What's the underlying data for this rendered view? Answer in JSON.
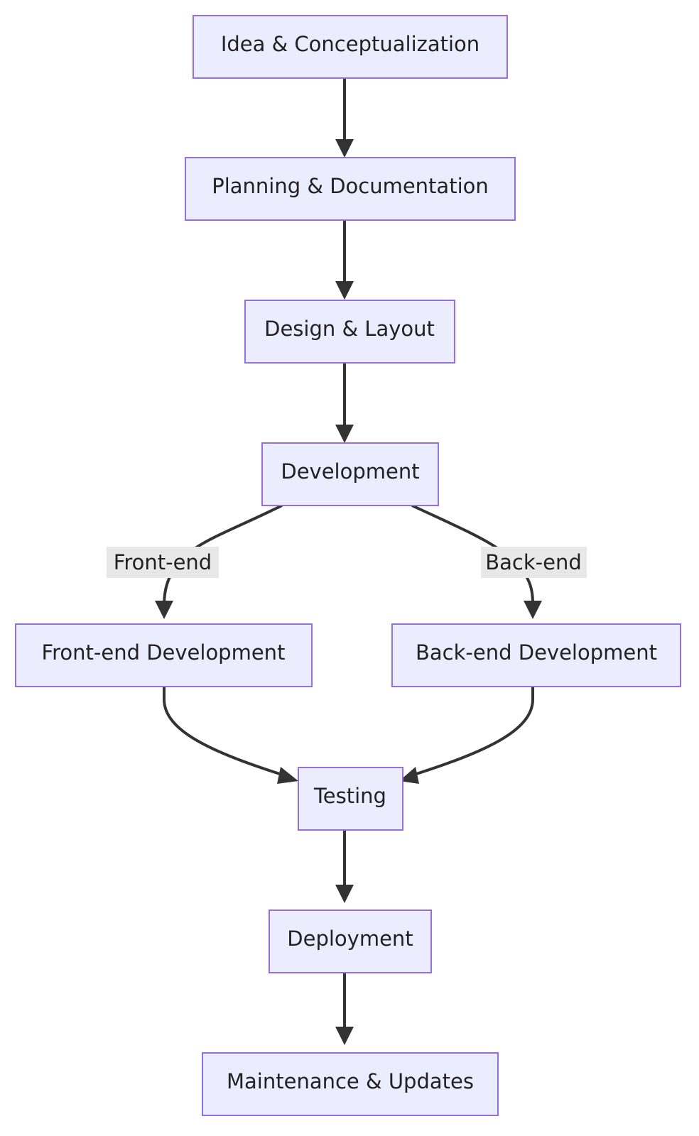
{
  "diagram": {
    "type": "flowchart",
    "direction": "top-to-bottom",
    "colors": {
      "node_fill": "#ECECFF",
      "node_stroke": "#9370DB",
      "edge": "#333333",
      "label_background": "#E8E8E8",
      "text": "#222222"
    },
    "nodes": [
      {
        "id": "idea",
        "label": "Idea & Conceptualization"
      },
      {
        "id": "planning",
        "label": "Planning & Documentation"
      },
      {
        "id": "design",
        "label": "Design & Layout"
      },
      {
        "id": "development",
        "label": "Development"
      },
      {
        "id": "frontend",
        "label": "Front-end Development"
      },
      {
        "id": "backend",
        "label": "Back-end Development"
      },
      {
        "id": "testing",
        "label": "Testing"
      },
      {
        "id": "deployment",
        "label": "Deployment"
      },
      {
        "id": "maintenance",
        "label": "Maintenance & Updates"
      }
    ],
    "edges": [
      {
        "from": "idea",
        "to": "planning",
        "label": ""
      },
      {
        "from": "planning",
        "to": "design",
        "label": ""
      },
      {
        "from": "design",
        "to": "development",
        "label": ""
      },
      {
        "from": "development",
        "to": "frontend",
        "label": "Front-end"
      },
      {
        "from": "development",
        "to": "backend",
        "label": "Back-end"
      },
      {
        "from": "frontend",
        "to": "testing",
        "label": ""
      },
      {
        "from": "backend",
        "to": "testing",
        "label": ""
      },
      {
        "from": "testing",
        "to": "deployment",
        "label": ""
      },
      {
        "from": "deployment",
        "to": "maintenance",
        "label": ""
      }
    ]
  }
}
